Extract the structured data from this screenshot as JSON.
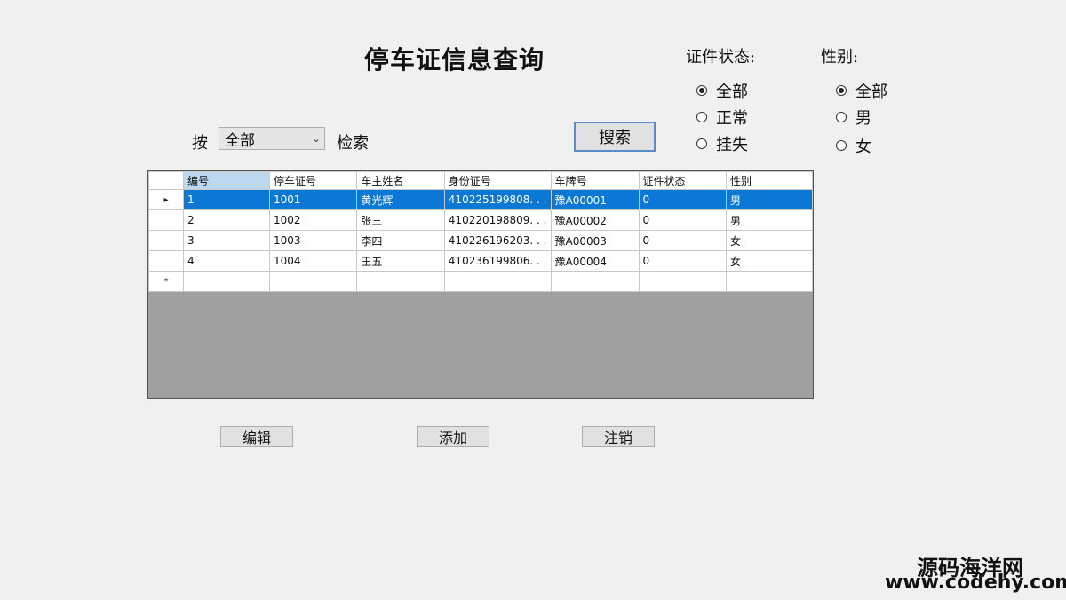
{
  "window": {
    "title": "停车证信息查询"
  },
  "status_group": {
    "label": "证件状态:",
    "options": [
      {
        "label": "全部",
        "checked": true
      },
      {
        "label": "正常",
        "checked": false
      },
      {
        "label": "挂失",
        "checked": false
      }
    ]
  },
  "gender_group": {
    "label": "性别:",
    "options": [
      {
        "label": "全部",
        "checked": true
      },
      {
        "label": "男",
        "checked": false
      },
      {
        "label": "女",
        "checked": false
      }
    ]
  },
  "search": {
    "prefix": "按",
    "suffix": "检索",
    "selected": "全部",
    "button": "搜索"
  },
  "grid": {
    "columns": [
      "编号",
      "停车证号",
      "车主姓名",
      "身份证号",
      "车牌号",
      "证件状态",
      "性别"
    ],
    "rows": [
      [
        "1",
        "1001",
        "黄光辉",
        "410225199808. . .",
        "豫A00001",
        "0",
        "男"
      ],
      [
        "2",
        "1002",
        "张三",
        "410220198809. . .",
        "豫A00002",
        "0",
        "男"
      ],
      [
        "3",
        "1003",
        "李四",
        "410226196203. . .",
        "豫A00003",
        "0",
        "女"
      ],
      [
        "4",
        "1004",
        "王五",
        "410236199806. . .",
        "豫A00004",
        "0",
        "女"
      ]
    ],
    "current_row_marker": "▸",
    "new_row_marker": "*"
  },
  "actions": {
    "edit": "编辑",
    "add": "添加",
    "cancel": "注销"
  },
  "watermark": {
    "name": "源码海洋网",
    "url": "www.codehy.com"
  }
}
